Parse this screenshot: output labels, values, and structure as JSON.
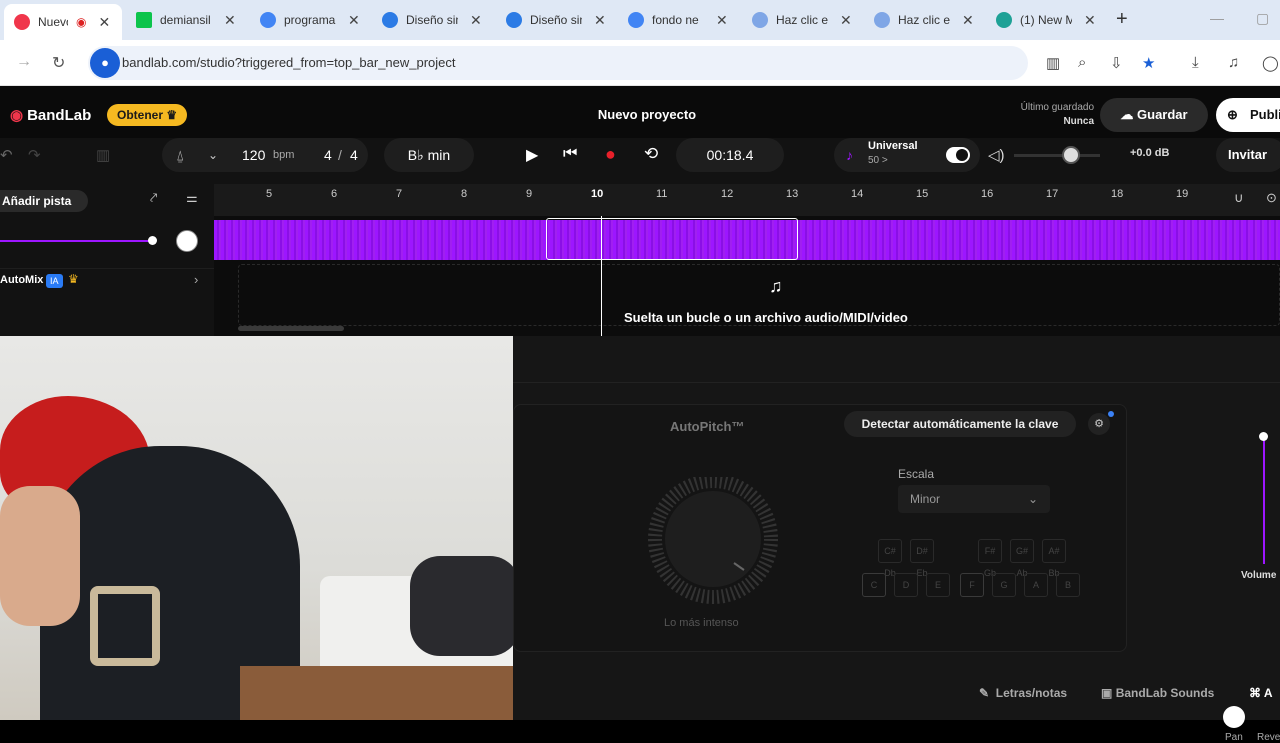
{
  "browser": {
    "tabs": [
      {
        "title": "Nuevo",
        "color": "#f0364b",
        "active": true
      },
      {
        "title": "demiansil",
        "color": "#0cc44c"
      },
      {
        "title": "programa",
        "color": "#4285f4"
      },
      {
        "title": "Diseño sin",
        "color": "#2c7be5"
      },
      {
        "title": "Diseño sin",
        "color": "#2c7be5"
      },
      {
        "title": "fondo ne",
        "color": "#4285f4"
      },
      {
        "title": "Haz clic e",
        "color": "#7fa6e6"
      },
      {
        "title": "Haz clic e",
        "color": "#7fa6e6"
      },
      {
        "title": "(1) New M",
        "color": "#1ea196"
      }
    ],
    "url": "bandlab.com/studio?triggered_from=top_bar_new_project"
  },
  "studio": {
    "logo": "BandLab",
    "obtener": "Obtener",
    "title": "Nuevo proyecto",
    "saved_label": "Último guardado",
    "saved_value": "Nunca",
    "guardar": "Guardar",
    "publicar": "Publi",
    "tempo": "120",
    "tempo_unit": "bpm",
    "signature_num": "4",
    "signature_den": "4",
    "key": "B♭ min",
    "time": "00:18.4",
    "preset_name": "Universal",
    "preset_sub": "50 >",
    "volume_db": "+0.0 dB",
    "invitar": "Invitar",
    "anadir_pista": "Añadir pista",
    "ruler_bars": [
      "5",
      "6",
      "7",
      "8",
      "9",
      "10",
      "11",
      "12",
      "13",
      "14",
      "15",
      "16",
      "17",
      "18",
      "19"
    ],
    "automix": "AutoMix",
    "automix_badge": "IA",
    "drop_text": "Suelta un bucle o un archivo audio/MIDI/video"
  },
  "panel": {
    "autopitch": "AutoPitch™",
    "detect": "Detectar automáticamente la clave",
    "escala_label": "Escala",
    "escala_value": "Minor",
    "knob_label": "Lo más intenso",
    "sharps": [
      "C#\nDb",
      "D#\nEb",
      "F#\nGb",
      "G#\nAb",
      "A#\nBb"
    ],
    "naturals": [
      "C",
      "D",
      "E",
      "F",
      "G",
      "A",
      "B"
    ],
    "volume_label": "Volume",
    "pan_label": "Pan",
    "rev_label": "Reve",
    "letras": "Letras/notas",
    "sounds": "BandLab Sounds"
  },
  "colors": {
    "waveform": "#9d16ff",
    "accent_yellow": "#f5b921",
    "record": "#e8202a"
  }
}
